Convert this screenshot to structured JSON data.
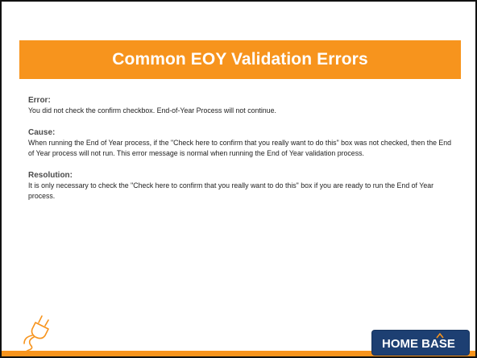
{
  "slide": {
    "title": "Common EOY Validation Errors",
    "sections": [
      {
        "heading": "Error:",
        "body": "You did not check the confirm checkbox. End-of-Year Process will not continue."
      },
      {
        "heading": "Cause:",
        "body": "When running the End of Year process, if the \"Check here to confirm that you really want to do this\" box was not checked, then the End of Year process will not run. This error message is normal when running the End of Year validation process."
      },
      {
        "heading": "Resolution:",
        "body": "It is only necessary to check the \"Check here to confirm that you really want to do this\" box if you are ready to run the End of Year process."
      }
    ]
  },
  "logo": {
    "text": "HOME BASE",
    "icon": "home-base-logo"
  },
  "plug_icon": "plug-icon",
  "colors": {
    "accent": "#f7941d",
    "logo_bg": "#1d3f72",
    "text": "#222222",
    "heading": "#4a4a4a"
  }
}
